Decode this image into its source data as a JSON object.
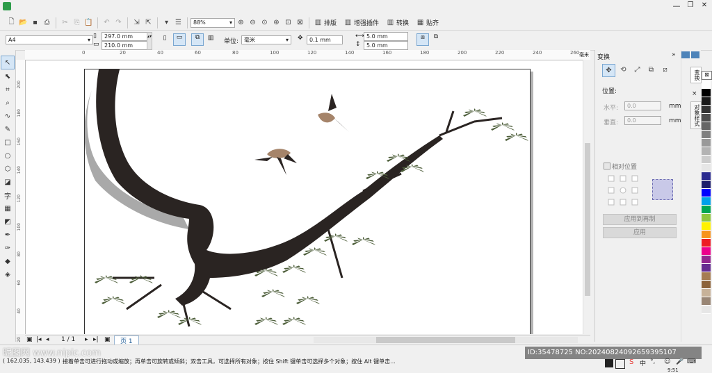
{
  "window": {
    "minimize": "—",
    "restore": "❐",
    "close": "✕"
  },
  "toolbar": {
    "zoom_value": "88%",
    "layout_label": "排版",
    "plugin_label": "增强插件",
    "convert_label": "转换",
    "snap_label": "贴齐"
  },
  "property_bar": {
    "page_preset": "A4",
    "width": "297.0 mm",
    "height": "210.0 mm",
    "units_label": "单位:",
    "units_value": "毫米",
    "nudge": "0.1 mm",
    "dup_x": "5.0 mm",
    "dup_y": "5.0 mm"
  },
  "ruler": {
    "unit": "毫米",
    "h_ticks": [
      "0",
      "20",
      "40",
      "60",
      "80",
      "100",
      "120",
      "140",
      "160",
      "180",
      "200",
      "220",
      "240",
      "260",
      "280"
    ],
    "v_ticks": [
      "200",
      "180",
      "160",
      "140",
      "120",
      "100",
      "80",
      "60",
      "40",
      "20"
    ]
  },
  "docker": {
    "title": "变换",
    "position_label": "位置:",
    "horizontal_label": "水平:",
    "horizontal_value": "0.0",
    "vertical_label": "垂直:",
    "vertical_value": "0.0",
    "unit": "mm",
    "relative_label": "相对位置",
    "apply_copy_label": "应用到再制",
    "apply_label": "应用",
    "side_tab_1": "变换",
    "side_tab_2": "对象样式"
  },
  "page_nav": {
    "counter": "1 / 1",
    "page_tab": "页 1"
  },
  "status": {
    "coords": "( 162.035, 143.439 )",
    "hint": "接着单击可进行拖动或缩放；再单击可旋转或倾斜；双击工具，可选择所有对象；按住 Shift 键单击可选择多个对象；按住 Alt 键单击...",
    "watermark_id": "ID:35478725 NO:20240824092659395107",
    "watermark_brand": "昵图网 www.nipic.com",
    "clock": "9:51"
  },
  "palette": [
    "#ffffff",
    "#000000",
    "#1a1a1a",
    "#333333",
    "#4d4d4d",
    "#666666",
    "#808080",
    "#999999",
    "#b3b3b3",
    "#cccccc",
    "#e6e6e6",
    "#2b2b8f",
    "#1c1c6b",
    "#0000ff",
    "#00a0e9",
    "#00a651",
    "#8dc63f",
    "#fff200",
    "#f7941d",
    "#ed1c24",
    "#ec008c",
    "#92278f",
    "#662d91",
    "#a67c52",
    "#8c6239",
    "#c7b299",
    "#998675",
    "#e6e6e6"
  ],
  "colors": {
    "accent": "#3c7fb1",
    "tree": "#2a2422",
    "needle": "#4d5e3a",
    "bird": "#a5846a"
  }
}
